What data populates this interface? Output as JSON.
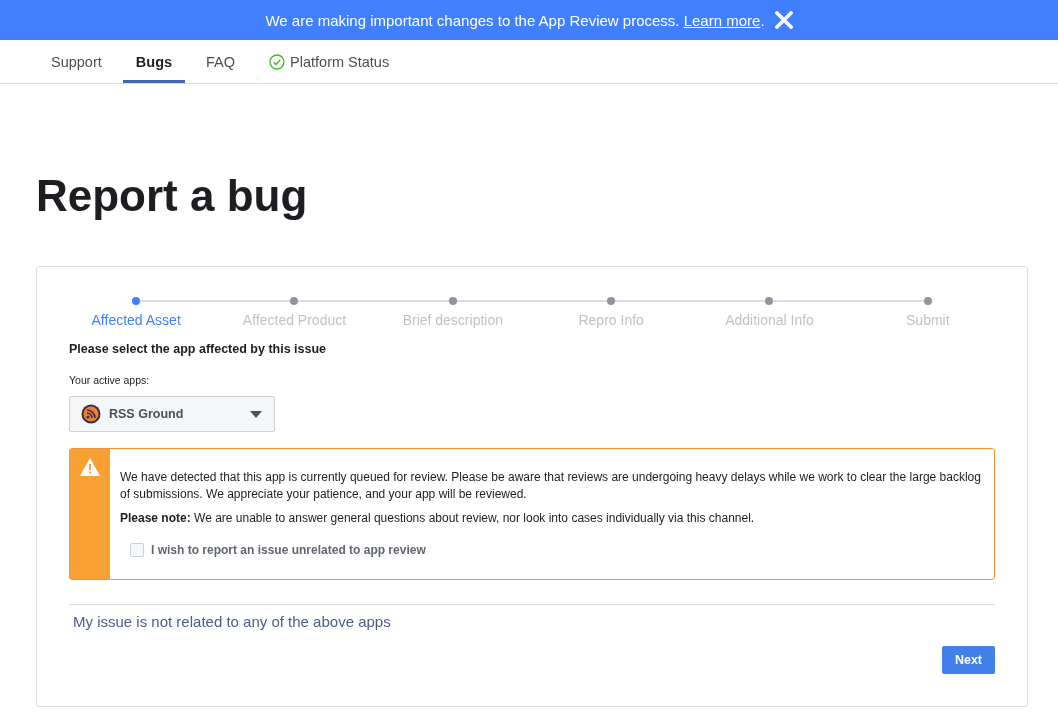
{
  "banner": {
    "message": "We are making important changes to the App Review process.",
    "link": "Learn more",
    "trailing": "."
  },
  "nav": {
    "tabs": [
      {
        "label": "Support",
        "selected": false,
        "kind": "plain"
      },
      {
        "label": "Bugs",
        "selected": true,
        "kind": "plain"
      },
      {
        "label": "FAQ",
        "selected": false,
        "kind": "plain"
      },
      {
        "label": "Platform Status",
        "selected": false,
        "kind": "status"
      }
    ]
  },
  "title": "Report a bug",
  "stepper": [
    {
      "label": "Affected Asset",
      "selected": true
    },
    {
      "label": "Affected Product",
      "selected": false
    },
    {
      "label": "Brief description",
      "selected": false
    },
    {
      "label": "Repro Info",
      "selected": false
    },
    {
      "label": "Additional Info",
      "selected": false
    },
    {
      "label": "Submit",
      "selected": false
    }
  ],
  "prompt": "Please select the app affected by this issue",
  "apps_label": "Your active apps:",
  "app_select": {
    "value": "RSS Ground"
  },
  "warning": {
    "paragraphs": [
      "We have detected that this app is currently queued for review. Please be aware that reviews are undergoing heavy delays while we work to clear the large backlog of submissions. We appreciate your patience, and your app will be reviewed.",
      "**Please note:** We are unable to answer general questions about review, nor look into cases individually via this channel."
    ],
    "checkbox": {
      "label": "I wish to report an issue unrelated to app review",
      "checked": false
    }
  },
  "unrelated_link": "My issue is not related to any of the above apps",
  "next_button": "Next"
}
